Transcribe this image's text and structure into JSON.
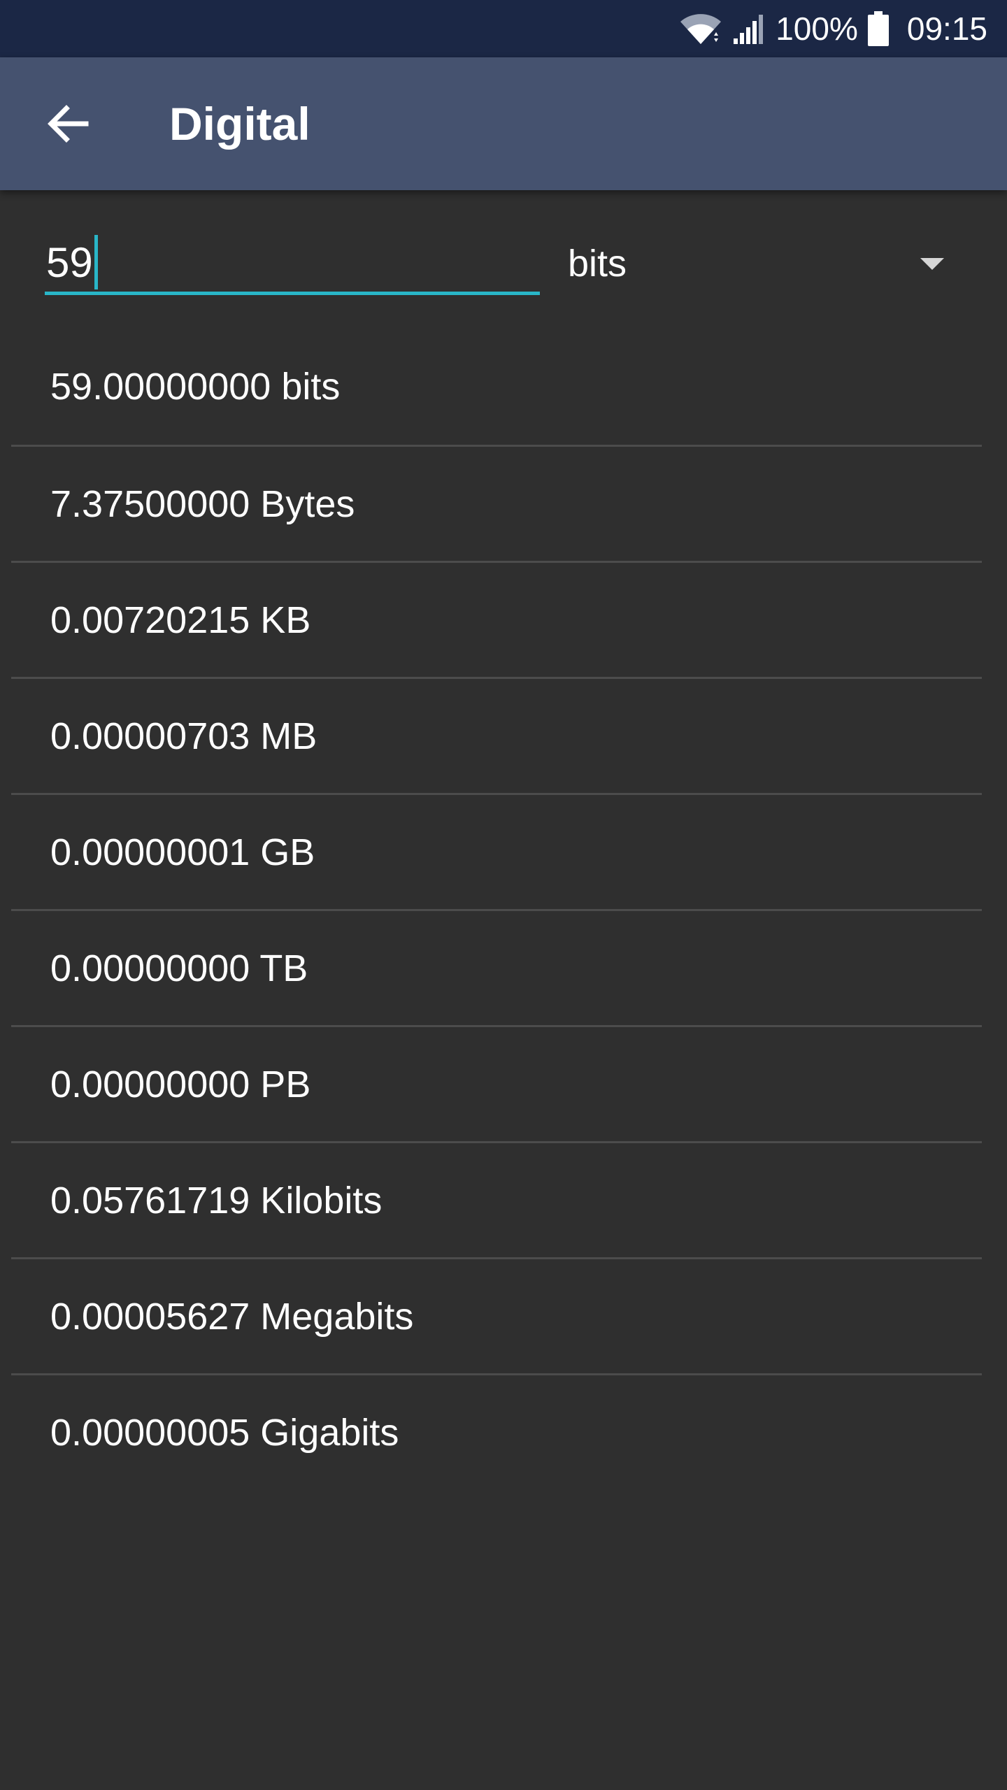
{
  "status_bar": {
    "battery_percent": "100%",
    "time": "09:15",
    "icons": [
      "wifi-icon",
      "signal-icon",
      "battery-icon"
    ]
  },
  "app_bar": {
    "title": "Digital",
    "back_icon": "back-arrow-icon"
  },
  "converter": {
    "input_value": "59",
    "selected_unit": "bits",
    "accent_color": "#29b6c8"
  },
  "results": [
    "59.00000000 bits",
    "7.37500000 Bytes",
    "0.00720215 KB",
    "0.00000703 MB",
    "0.00000001 GB",
    "0.00000000 TB",
    "0.00000000 PB",
    "0.05761719 Kilobits",
    "0.00005627 Megabits",
    "0.00000005 Gigabits"
  ]
}
